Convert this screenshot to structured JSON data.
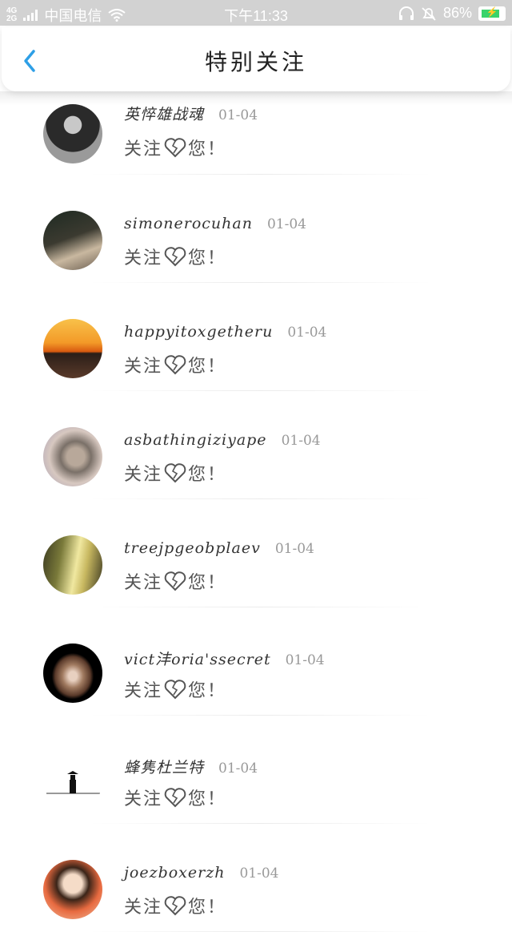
{
  "statusbar": {
    "network": "4G",
    "network_sub": "2G",
    "carrier": "中国电信",
    "time": "下午11:33",
    "battery": "86%",
    "battery_level": 0.86
  },
  "header": {
    "title": "特别关注"
  },
  "items": [
    {
      "name": "英悴雄战魂",
      "date": "01-04",
      "msg_before": "关注",
      "msg_after": "您！"
    },
    {
      "name": "simonerocuhan",
      "date": "01-04",
      "msg_before": "关注",
      "msg_after": "您！"
    },
    {
      "name": "happyitoxgetheru",
      "date": "01-04",
      "msg_before": "关注",
      "msg_after": "您！"
    },
    {
      "name": "asbathingiziyape",
      "date": "01-04",
      "msg_before": "关注",
      "msg_after": "您！"
    },
    {
      "name": "treejpgeobplaev",
      "date": "01-04",
      "msg_before": "关注",
      "msg_after": "您！"
    },
    {
      "name": "vict沣oria'ssecret",
      "date": "01-04",
      "msg_before": "关注",
      "msg_after": "您！"
    },
    {
      "name": "蜂隽杜兰特",
      "date": "01-04",
      "msg_before": "关注",
      "msg_after": "您！"
    },
    {
      "name": "joezboxerzh",
      "date": "01-04",
      "msg_before": "关注",
      "msg_after": "您！"
    }
  ]
}
